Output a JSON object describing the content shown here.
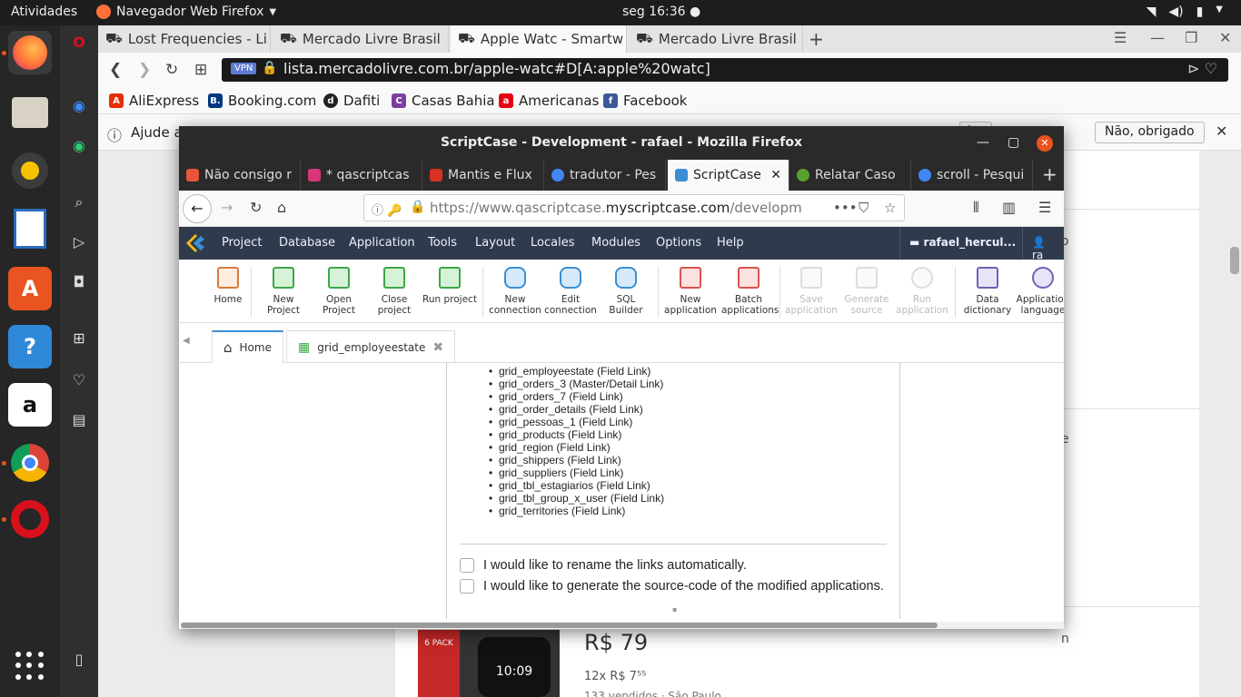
{
  "topbar": {
    "activities": "Atividades",
    "app_menu": "Navegador Web Firefox",
    "clock": "seg 16:36"
  },
  "outer_browser": {
    "tabs": [
      {
        "label": "Lost Frequencies - Li"
      },
      {
        "label": "Mercado Livre Brasil"
      },
      {
        "label": "Apple Watc - Smartw"
      },
      {
        "label": "Mercado Livre Brasil"
      }
    ],
    "url": "lista.mercadolivre.com.br/apple-watc#D[A:apple%20watc]",
    "vpn": "VPN",
    "bookmarks": [
      {
        "label": "AliExpress",
        "color": "#e62e04",
        "glyph": "A"
      },
      {
        "label": "Booking.com",
        "color": "#003580",
        "glyph": "B."
      },
      {
        "label": "Dafiti",
        "color": "#222222",
        "glyph": "d"
      },
      {
        "label": "Casas Bahia",
        "color": "#7b3fa0",
        "glyph": "C"
      },
      {
        "label": "Americanas",
        "color": "#e60014",
        "glyph": "a"
      },
      {
        "label": "Facebook",
        "color": "#3b5998",
        "glyph": "f"
      }
    ],
    "notification": {
      "text": "Ajude a",
      "btn_partial": "lar",
      "btn_no": "Não, obrigado"
    },
    "page": {
      "side_fragment_1": "o",
      "side_fragment_2": "e",
      "side_fragment_3": "n",
      "pack_label": "6 PACK",
      "watch_time": "10:09",
      "price": "R$ 79",
      "installments": "12x R$ 7⁵⁵",
      "sold": "133 vendidos · São Paulo"
    }
  },
  "window": {
    "title": "ScriptCase - Development - rafael - Mozilla Firefox",
    "tabs": [
      {
        "label": "Não consigo r",
        "color": "#e9553c"
      },
      {
        "label": "* qascriptcas",
        "color": "#d8357a"
      },
      {
        "label": "Mantis e Flux",
        "color": "#d93025"
      },
      {
        "label": "tradutor - Pes",
        "color": "#4285f4"
      },
      {
        "label": "ScriptCase",
        "color": "#3a8fd4"
      },
      {
        "label": "Relatar Caso",
        "color": "#5aa02c"
      },
      {
        "label": "scroll - Pesqui",
        "color": "#4285f4"
      }
    ],
    "url_prefix": "https://www.qascriptcase.",
    "url_domain": "myscriptcase.com",
    "url_suffix": "/development/s"
  },
  "scriptcase": {
    "menu": [
      "Project",
      "Database",
      "Application",
      "Tools",
      "Layout",
      "Locales",
      "Modules",
      "Options",
      "Help"
    ],
    "user_folder": "rafael_hercul...",
    "user_short": "ra",
    "toolbar": [
      {
        "label": "Home"
      },
      {
        "label": "New Project"
      },
      {
        "label": "Open Project"
      },
      {
        "label": "Close project"
      },
      {
        "label": "Run project"
      },
      {
        "label": "New connection"
      },
      {
        "label": "Edit connection"
      },
      {
        "label": "SQL Builder"
      },
      {
        "label": "New application"
      },
      {
        "label": "Batch applications"
      },
      {
        "label": "Save application"
      },
      {
        "label": "Generate source"
      },
      {
        "label": "Run application"
      },
      {
        "label": "Data dictionary"
      },
      {
        "label": "Application language"
      }
    ],
    "doc_tabs": [
      {
        "label": "Home"
      },
      {
        "label": "grid_employeestate"
      }
    ],
    "links": [
      "grid_employeestate (Field Link)",
      "grid_orders_3 (Master/Detail Link)",
      "grid_orders_7 (Field Link)",
      "grid_order_details (Field Link)",
      "grid_pessoas_1 (Field Link)",
      "grid_products (Field Link)",
      "grid_region (Field Link)",
      "grid_shippers (Field Link)",
      "grid_suppliers (Field Link)",
      "grid_tbl_estagiarios (Field Link)",
      "grid_tbl_group_x_user (Field Link)",
      "grid_territories (Field Link)"
    ],
    "options": {
      "rename": "I would like to rename the links automatically.",
      "generate": "I would like to generate the source-code of the modified applications."
    }
  }
}
